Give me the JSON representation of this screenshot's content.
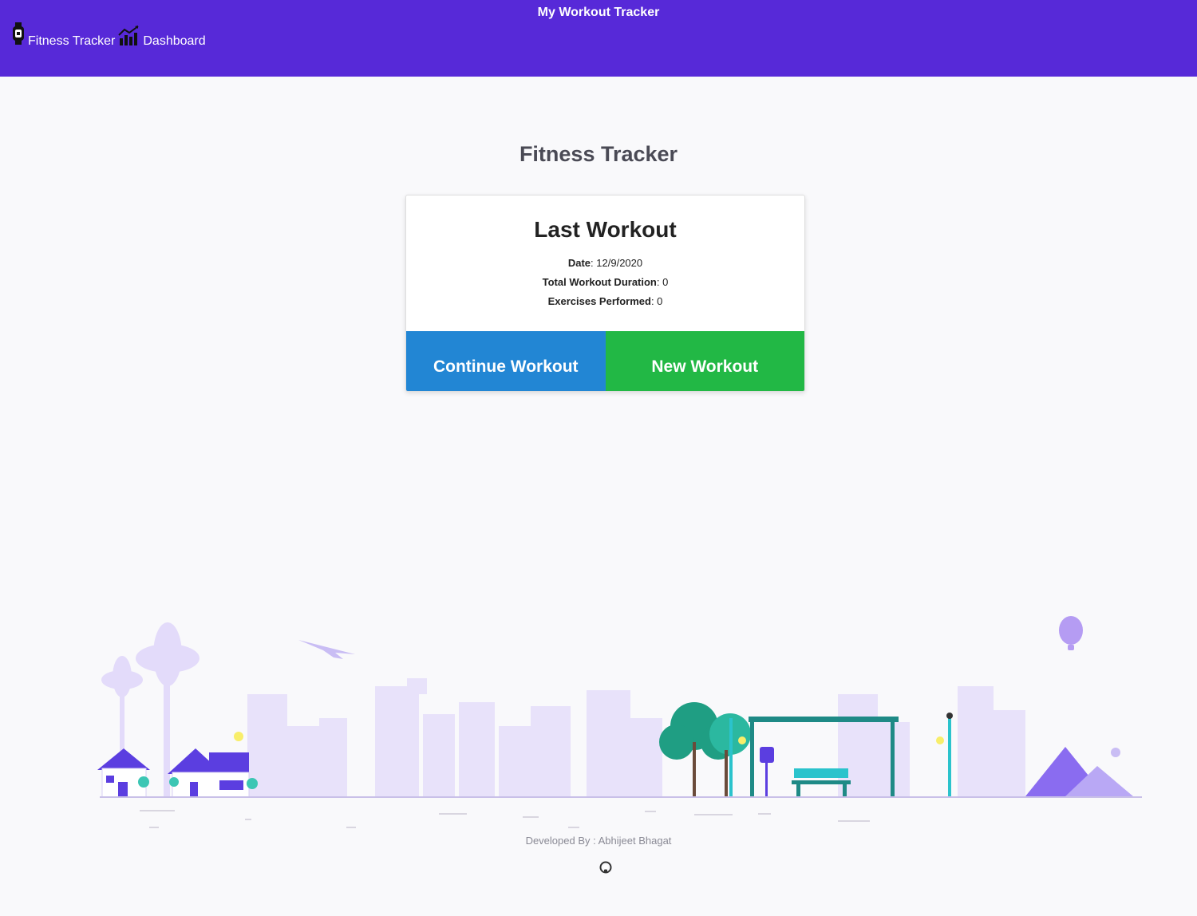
{
  "header": {
    "title": "My Workout Tracker",
    "nav": [
      {
        "label": "Fitness Tracker",
        "icon": "smartwatch-icon"
      },
      {
        "label": "Dashboard",
        "icon": "chart-bars-icon"
      }
    ]
  },
  "main": {
    "page_title": "Fitness Tracker",
    "card": {
      "title": "Last Workout",
      "stats": [
        {
          "label": "Date",
          "value": "12/9/2020"
        },
        {
          "label": "Total Workout Duration",
          "value": "0"
        },
        {
          "label": "Exercises Performed",
          "value": "0"
        }
      ],
      "buttons": {
        "continue": "Continue Workout",
        "new": "New Workout"
      }
    }
  },
  "footer": {
    "developer": "Developed By : Abhijeet Bhagat",
    "link_icon": "github-icon"
  },
  "colors": {
    "header_bg": "#5729d8",
    "continue_bg": "#2286d4",
    "new_bg": "#22b845",
    "illustration_accent": "#5b3ee0",
    "illustration_teal": "#1e8a86"
  }
}
